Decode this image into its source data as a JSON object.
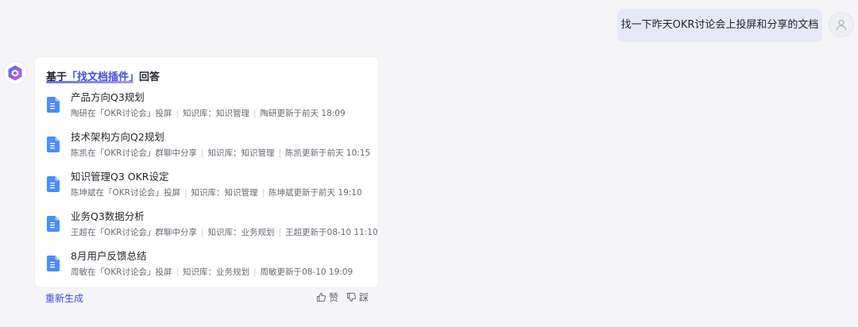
{
  "user_message": {
    "text": "找一下昨天OKR讨论会上投屏和分享的文档"
  },
  "answer": {
    "heading_prefix": "基于",
    "heading_plugin": "「找文档插件」",
    "heading_suffix": "回答",
    "sep": "|",
    "documents": [
      {
        "title": "产品方向Q3规划",
        "source": "陶研在「OKR讨论会」投屏",
        "library": "知识库：知识管理",
        "updated": "陶研更新于前天 18:09"
      },
      {
        "title": "技术架构方向Q2规划",
        "source": "陈凯在「OKR讨论会」群聊中分享",
        "library": "知识库：知识管理",
        "updated": "陈凯更新于前天 10:15"
      },
      {
        "title": "知识管理Q3 OKR设定",
        "source": "陈坤斌在「OKR讨论会」投屏",
        "library": "知识库：知识管理",
        "updated": "陈坤斌更新于前天 19:10"
      },
      {
        "title": "业务Q3数据分析",
        "source": "王超在「OKR讨论会」群聊中分享",
        "library": "知识库：业务规划",
        "updated": "王超更新于08-10 11:10"
      },
      {
        "title": "8月用户反馈总结",
        "source": "周敏在「OKR讨论会」投屏",
        "library": "知识库：业务规划",
        "updated": "周敏更新于08-10 19:09"
      }
    ]
  },
  "actions": {
    "regenerate": "重新生成",
    "like": "赞",
    "dislike": "踩"
  },
  "colors": {
    "accent": "#3b4de0",
    "user_bubble": "#e6e8f8",
    "doc_icon": "#4a8df8",
    "background": "#f5f5f8"
  },
  "icons": {
    "user_avatar": "user-icon",
    "bot_avatar": "bot-logo-icon",
    "document": "document-icon",
    "like": "thumbs-up-icon",
    "dislike": "thumbs-down-icon"
  }
}
